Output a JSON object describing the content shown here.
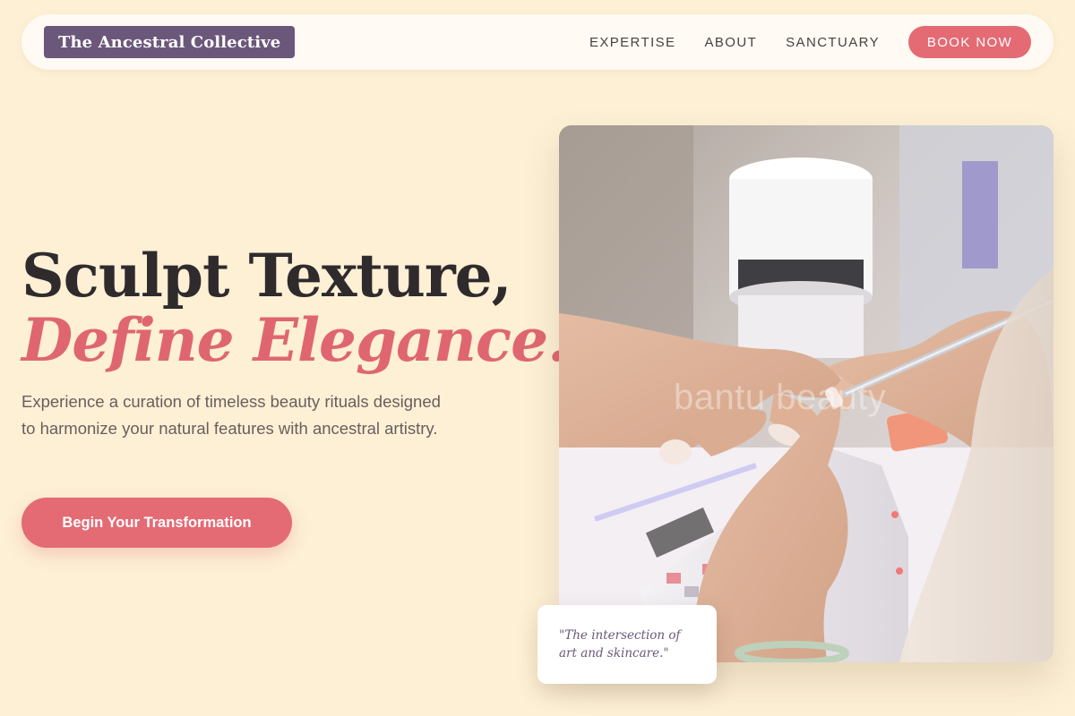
{
  "nav": {
    "logo": "The Ancestral Collective",
    "links": [
      "EXPERTISE",
      "ABOUT",
      "SANCTUARY"
    ],
    "cta": "BOOK NOW"
  },
  "hero": {
    "headline_line1": "Sculpt Texture,",
    "headline_line2": "Define Elegance.",
    "subcopy": "Experience a curation of timeless beauty rituals designed to harmonize your natural features with ancestral artistry.",
    "cta": "Begin Your Transformation",
    "image_watermark": "bantu beauty",
    "quote": "\"The intersection of art and skincare.\""
  },
  "colors": {
    "background": "#fdf0d5",
    "accent": "#e46a74",
    "brand_purple": "#6b577a",
    "heading_dark": "#2f2b2d"
  }
}
